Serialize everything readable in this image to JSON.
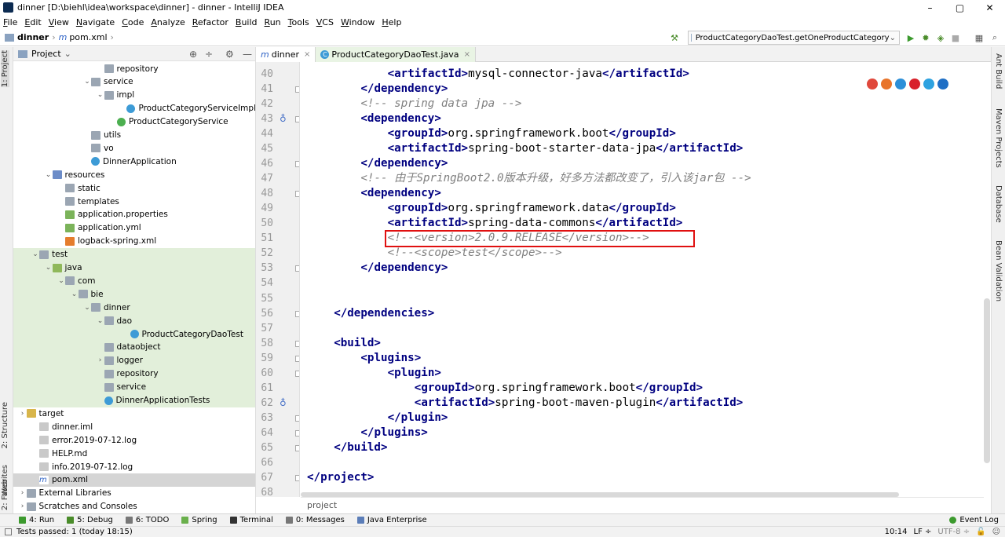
{
  "window": {
    "title": "dinner [D:\\biehl\\idea\\workspace\\dinner] - dinner - IntelliJ IDEA",
    "minimize": "–",
    "maximize": "▢",
    "close": "✕"
  },
  "menu": [
    "File",
    "Edit",
    "View",
    "Navigate",
    "Code",
    "Analyze",
    "Refactor",
    "Build",
    "Run",
    "Tools",
    "VCS",
    "Window",
    "Help"
  ],
  "breadcrumb": {
    "project": "dinner",
    "file": "pom.xml"
  },
  "run_config": {
    "label": "ProductCategoryDaoTest.getOneProductCategory"
  },
  "left_stripe": {
    "project": "1: Project",
    "structure": "2: Structure",
    "favorites": "2: Favorites",
    "web": "Web"
  },
  "right_stripe": {
    "ant": "Ant Build",
    "maven": "Maven Projects",
    "database": "Database",
    "bean": "Bean Validation"
  },
  "project_panel": {
    "title": "Project"
  },
  "tree": [
    {
      "label": "repository",
      "indent": 7,
      "arrow": "",
      "icon": "folder"
    },
    {
      "label": "service",
      "indent": 6,
      "arrow": "⌄",
      "icon": "folder"
    },
    {
      "label": "impl",
      "indent": 7,
      "arrow": "⌄",
      "icon": "folder"
    },
    {
      "label": "ProductCategoryServiceImpl",
      "indent": 9,
      "arrow": "",
      "icon": "cls"
    },
    {
      "label": "ProductCategoryService",
      "indent": 8,
      "arrow": "",
      "icon": "iface"
    },
    {
      "label": "utils",
      "indent": 6,
      "arrow": "",
      "icon": "folder"
    },
    {
      "label": "vo",
      "indent": 6,
      "arrow": "",
      "icon": "folder"
    },
    {
      "label": "DinnerApplication",
      "indent": 6,
      "arrow": "",
      "icon": "cls"
    },
    {
      "label": "resources",
      "indent": 3,
      "arrow": "⌄",
      "icon": "folder-b"
    },
    {
      "label": "static",
      "indent": 4,
      "arrow": "",
      "icon": "folder"
    },
    {
      "label": "templates",
      "indent": 4,
      "arrow": "",
      "icon": "folder"
    },
    {
      "label": "application.properties",
      "indent": 4,
      "arrow": "",
      "icon": "props"
    },
    {
      "label": "application.yml",
      "indent": 4,
      "arrow": "",
      "icon": "props"
    },
    {
      "label": "logback-spring.xml",
      "indent": 4,
      "arrow": "",
      "icon": "xml"
    },
    {
      "label": "test",
      "indent": 2,
      "arrow": "⌄",
      "icon": "folder"
    },
    {
      "label": "java",
      "indent": 3,
      "arrow": "⌄",
      "icon": "folder-g"
    },
    {
      "label": "com",
      "indent": 4,
      "arrow": "⌄",
      "icon": "folder"
    },
    {
      "label": "bie",
      "indent": 5,
      "arrow": "⌄",
      "icon": "folder"
    },
    {
      "label": "dinner",
      "indent": 6,
      "arrow": "⌄",
      "icon": "folder"
    },
    {
      "label": "dao",
      "indent": 7,
      "arrow": "⌄",
      "icon": "folder"
    },
    {
      "label": "ProductCategoryDaoTest",
      "indent": 9,
      "arrow": "",
      "icon": "cls"
    },
    {
      "label": "dataobject",
      "indent": 7,
      "arrow": "",
      "icon": "folder"
    },
    {
      "label": "logger",
      "indent": 7,
      "arrow": "›",
      "icon": "folder"
    },
    {
      "label": "repository",
      "indent": 7,
      "arrow": "",
      "icon": "folder"
    },
    {
      "label": "service",
      "indent": 7,
      "arrow": "",
      "icon": "folder"
    },
    {
      "label": "DinnerApplicationTests",
      "indent": 7,
      "arrow": "",
      "icon": "cls"
    },
    {
      "label": "target",
      "indent": 1,
      "arrow": "›",
      "icon": "folder-y"
    },
    {
      "label": "dinner.iml",
      "indent": 2,
      "arrow": "",
      "icon": "file"
    },
    {
      "label": "error.2019-07-12.log",
      "indent": 2,
      "arrow": "",
      "icon": "file"
    },
    {
      "label": "HELP.md",
      "indent": 2,
      "arrow": "",
      "icon": "file"
    },
    {
      "label": "info.2019-07-12.log",
      "indent": 2,
      "arrow": "",
      "icon": "file"
    },
    {
      "label": "pom.xml",
      "indent": 2,
      "arrow": "",
      "icon": "pom"
    },
    {
      "label": "External Libraries",
      "indent": 1,
      "arrow": "›",
      "icon": "folder"
    },
    {
      "label": "Scratches and Consoles",
      "indent": 1,
      "arrow": "›",
      "icon": "folder"
    }
  ],
  "editor_tabs": [
    {
      "label": "dinner",
      "prefix": "m",
      "close": "×"
    },
    {
      "label": "ProductCategoryDaoTest.java",
      "prefix": "C",
      "close": "×"
    }
  ],
  "code_lines": [
    {
      "n": "40",
      "indent": 3,
      "segs": [
        {
          "t": "<artifactId>",
          "k": "tag"
        },
        {
          "t": "mysql-connector-java",
          "k": "txt"
        },
        {
          "t": "</artifactId>",
          "k": "tag"
        }
      ]
    },
    {
      "n": "41",
      "indent": 2,
      "segs": [
        {
          "t": "</dependency>",
          "k": "tag"
        }
      ]
    },
    {
      "n": "42",
      "indent": 2,
      "segs": [
        {
          "t": "<!-- spring data jpa -->",
          "k": "cm"
        }
      ]
    },
    {
      "n": "43",
      "indent": 2,
      "segs": [
        {
          "t": "<dependency>",
          "k": "tag"
        }
      ]
    },
    {
      "n": "44",
      "indent": 3,
      "segs": [
        {
          "t": "<groupId>",
          "k": "tag"
        },
        {
          "t": "org.springframework.boot",
          "k": "txt"
        },
        {
          "t": "</groupId>",
          "k": "tag"
        }
      ]
    },
    {
      "n": "45",
      "indent": 3,
      "segs": [
        {
          "t": "<artifactId>",
          "k": "tag"
        },
        {
          "t": "spring-boot-starter-data-jpa",
          "k": "txt"
        },
        {
          "t": "</artifactId>",
          "k": "tag"
        }
      ]
    },
    {
      "n": "46",
      "indent": 2,
      "segs": [
        {
          "t": "</dependency>",
          "k": "tag"
        }
      ]
    },
    {
      "n": "47",
      "indent": 2,
      "segs": [
        {
          "t": "<!-- 由于SpringBoot2.0版本升级，好多方法都改变了，引入该jar包 -->",
          "k": "cm"
        }
      ]
    },
    {
      "n": "48",
      "indent": 2,
      "segs": [
        {
          "t": "<dependency>",
          "k": "tag"
        }
      ]
    },
    {
      "n": "49",
      "indent": 3,
      "segs": [
        {
          "t": "<groupId>",
          "k": "tag"
        },
        {
          "t": "org.springframework.data",
          "k": "txt"
        },
        {
          "t": "</groupId>",
          "k": "tag"
        }
      ]
    },
    {
      "n": "50",
      "indent": 3,
      "segs": [
        {
          "t": "<artifactId>",
          "k": "tag"
        },
        {
          "t": "spring-data-commons",
          "k": "txt"
        },
        {
          "t": "</artifactId>",
          "k": "tag"
        }
      ]
    },
    {
      "n": "51",
      "indent": 3,
      "segs": [
        {
          "t": "<!--<version>2.0.9.RELEASE</version>-->",
          "k": "cm"
        }
      ]
    },
    {
      "n": "52",
      "indent": 3,
      "segs": [
        {
          "t": "<!--<scope>test</scope>-->",
          "k": "cm"
        }
      ]
    },
    {
      "n": "53",
      "indent": 2,
      "segs": [
        {
          "t": "</dependency>",
          "k": "tag"
        }
      ]
    },
    {
      "n": "54",
      "indent": 0,
      "segs": []
    },
    {
      "n": "55",
      "indent": 0,
      "segs": []
    },
    {
      "n": "56",
      "indent": 1,
      "segs": [
        {
          "t": "</dependencies>",
          "k": "tag"
        }
      ]
    },
    {
      "n": "57",
      "indent": 0,
      "segs": []
    },
    {
      "n": "58",
      "indent": 1,
      "segs": [
        {
          "t": "<build>",
          "k": "tag"
        }
      ]
    },
    {
      "n": "59",
      "indent": 2,
      "segs": [
        {
          "t": "<plugins>",
          "k": "tag"
        }
      ]
    },
    {
      "n": "60",
      "indent": 3,
      "segs": [
        {
          "t": "<plugin>",
          "k": "tag"
        }
      ]
    },
    {
      "n": "61",
      "indent": 4,
      "segs": [
        {
          "t": "<groupId>",
          "k": "tag"
        },
        {
          "t": "org.springframework.boot",
          "k": "txt"
        },
        {
          "t": "</groupId>",
          "k": "tag"
        }
      ]
    },
    {
      "n": "62",
      "indent": 4,
      "segs": [
        {
          "t": "<artifactId>",
          "k": "tag"
        },
        {
          "t": "spring-boot-maven-plugin",
          "k": "txt"
        },
        {
          "t": "</artifactId>",
          "k": "tag"
        }
      ]
    },
    {
      "n": "63",
      "indent": 3,
      "segs": [
        {
          "t": "</plugin>",
          "k": "tag"
        }
      ]
    },
    {
      "n": "64",
      "indent": 2,
      "segs": [
        {
          "t": "</plugins>",
          "k": "tag"
        }
      ]
    },
    {
      "n": "65",
      "indent": 1,
      "segs": [
        {
          "t": "</build>",
          "k": "tag"
        }
      ]
    },
    {
      "n": "66",
      "indent": 0,
      "segs": []
    },
    {
      "n": "67",
      "indent": 0,
      "segs": [
        {
          "t": "</project>",
          "k": "tag"
        }
      ]
    },
    {
      "n": "68",
      "indent": 0,
      "segs": []
    }
  ],
  "editor_breadcrumb": "project",
  "tool_windows": [
    {
      "label": "4: Run"
    },
    {
      "label": "5: Debug"
    },
    {
      "label": "6: TODO"
    },
    {
      "label": "Spring"
    },
    {
      "label": "Terminal"
    },
    {
      "label": "0: Messages"
    },
    {
      "label": "Java Enterprise"
    }
  ],
  "event_log": "Event Log",
  "status": {
    "left": "Tests passed: 1 (today 18:15)",
    "position": "10:14",
    "line_sep": "LF ÷",
    "encoding": "UTF-8 ÷"
  },
  "colors": {
    "tag": "#000080",
    "comment": "#808080",
    "highlight_box": "#e01010",
    "test_green": "#e2efda"
  }
}
